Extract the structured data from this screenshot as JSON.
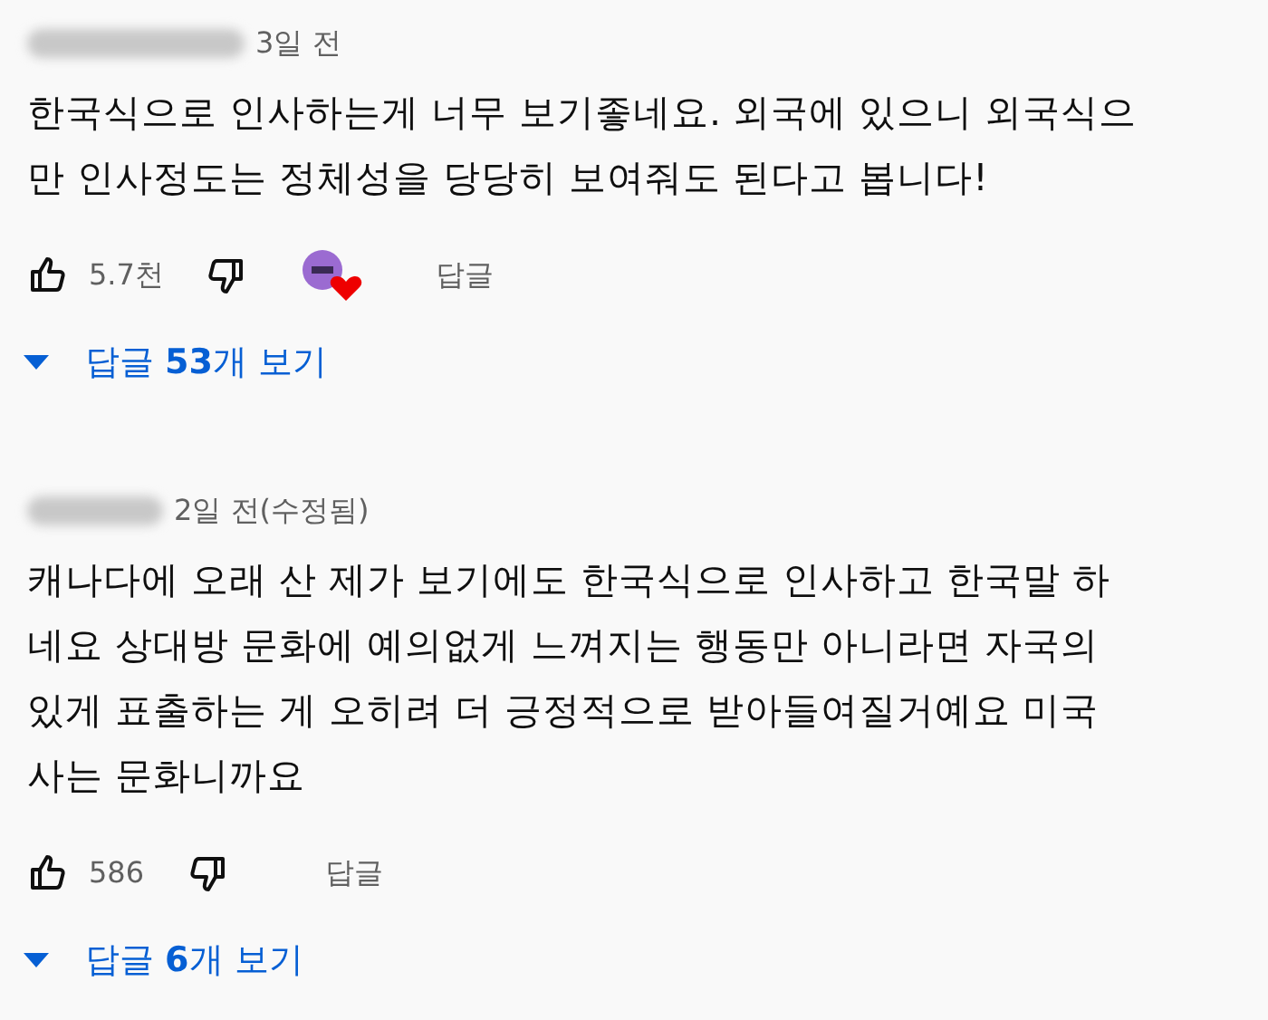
{
  "comments": [
    {
      "time": "3일 전",
      "text_lines": [
        "한국식으로 인사하는게 너무 보기좋네요. 외국에 있으니 외국식으",
        "만 인사정도는 정체성을 당당히 보여줘도 된다고 봅니다!"
      ],
      "likes": "5.7천",
      "creator_hearted": true,
      "reply_label": "답글",
      "replies": {
        "prefix": "답글 ",
        "count": "53",
        "suffix": "개 보기"
      }
    },
    {
      "time": "2일 전(수정됨)",
      "text_lines": [
        "캐나다에 오래 산 제가 보기에도 한국식으로 인사하고 한국말 하",
        "네요 상대방 문화에 예의없게 느껴지는 행동만 아니라면 자국의",
        "있게 표출하는 게 오히려 더 긍정적으로 받아들여질거예요 미국",
        "사는 문화니까요"
      ],
      "likes": "586",
      "creator_hearted": false,
      "reply_label": "답글",
      "replies": {
        "prefix": "답글 ",
        "count": "6",
        "suffix": "개 보기"
      }
    }
  ]
}
